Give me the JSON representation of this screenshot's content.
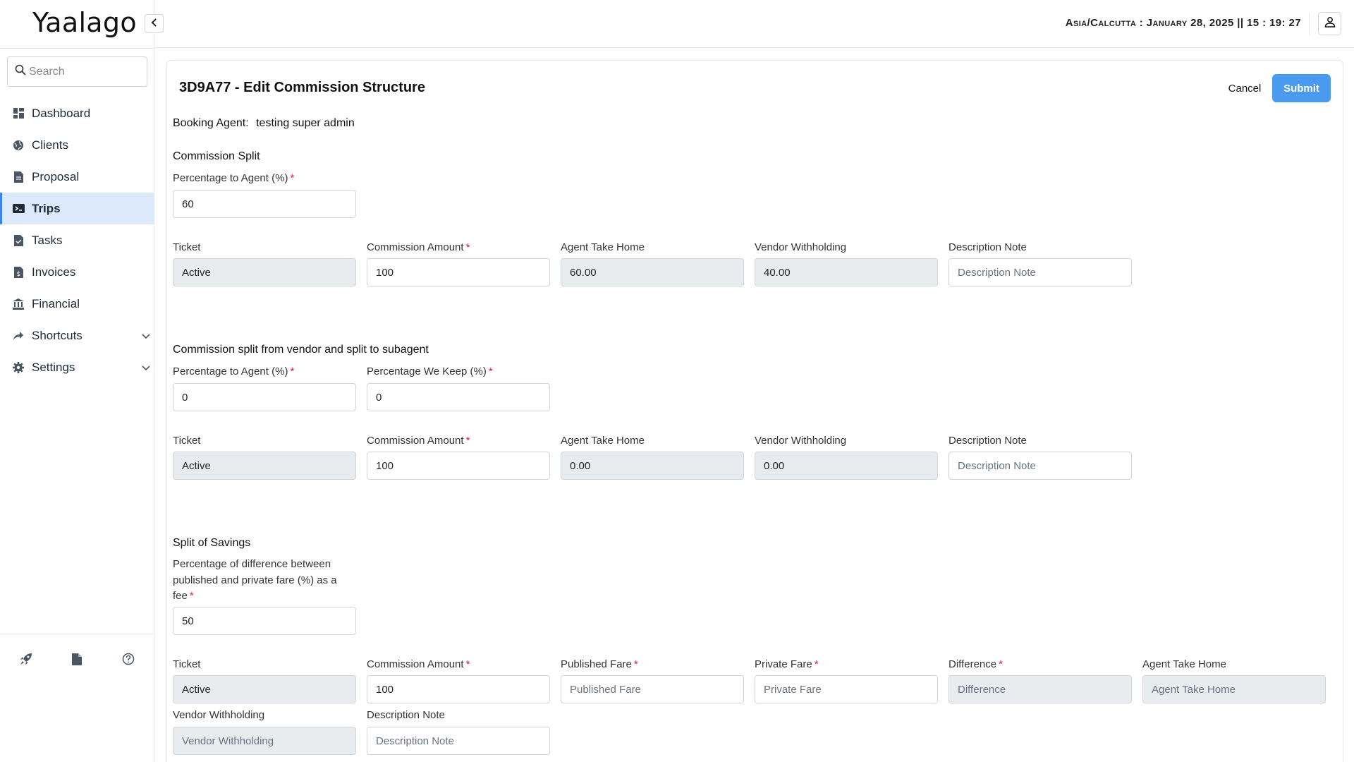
{
  "app": {
    "brand": "Yaalago"
  },
  "search": {
    "placeholder": "Search"
  },
  "sidebar": {
    "items": [
      {
        "label": "Dashboard",
        "icon": "dashboard-icon"
      },
      {
        "label": "Clients",
        "icon": "globe-icon"
      },
      {
        "label": "Proposal",
        "icon": "document-icon"
      },
      {
        "label": "Trips",
        "icon": "ticket-icon",
        "active": true
      },
      {
        "label": "Tasks",
        "icon": "task-icon"
      },
      {
        "label": "Invoices",
        "icon": "invoice-icon"
      },
      {
        "label": "Financial",
        "icon": "bank-icon"
      },
      {
        "label": "Shortcuts",
        "icon": "share-icon",
        "expandable": true
      },
      {
        "label": "Settings",
        "icon": "gear-icon",
        "expandable": true
      }
    ],
    "bottom_icons": [
      "rocket-icon",
      "file-icon",
      "help-icon"
    ]
  },
  "topbar": {
    "clock": "Asia/Calcutta : January 28, 2025 || 15 : 19: 27"
  },
  "page": {
    "title": "3D9A77 - Edit Commission Structure",
    "cancel_label": "Cancel",
    "submit_label": "Submit",
    "booking_agent_label": "Booking Agent:",
    "booking_agent_value": "testing super admin"
  },
  "commission_split": {
    "title": "Commission Split",
    "pct_label": "Percentage to Agent (%)",
    "pct_value": "60",
    "row": {
      "ticket_label": "Ticket",
      "ticket_value": "Active",
      "amount_label": "Commission Amount",
      "amount_value": "100",
      "take_home_label": "Agent Take Home",
      "take_home_value": "60.00",
      "withholding_label": "Vendor Withholding",
      "withholding_value": "40.00",
      "note_label": "Description Note",
      "note_placeholder": "Description Note"
    }
  },
  "vendor_split": {
    "title": "Commission split from vendor and split to subagent",
    "pct_agent_label": "Percentage to Agent (%)",
    "pct_agent_value": "0",
    "pct_keep_label": "Percentage We Keep (%)",
    "pct_keep_value": "0",
    "row": {
      "ticket_label": "Ticket",
      "ticket_value": "Active",
      "amount_label": "Commission Amount",
      "amount_value": "100",
      "take_home_label": "Agent Take Home",
      "take_home_value": "0.00",
      "withholding_label": "Vendor Withholding",
      "withholding_value": "0.00",
      "note_label": "Description Note",
      "note_placeholder": "Description Note"
    }
  },
  "savings_split": {
    "title": "Split of Savings",
    "pct_label_line1": "Percentage of difference between",
    "pct_label_line2": "published and private fare (%) as a",
    "pct_label_line3": "fee",
    "pct_value": "50",
    "row": {
      "ticket_label": "Ticket",
      "ticket_value": "Active",
      "amount_label": "Commission Amount",
      "amount_value": "100",
      "published_label": "Published Fare",
      "published_placeholder": "Published Fare",
      "private_label": "Private Fare",
      "private_placeholder": "Private Fare",
      "difference_label": "Difference",
      "difference_placeholder": "Difference",
      "take_home_label": "Agent Take Home",
      "take_home_placeholder": "Agent Take Home",
      "withholding_label": "Vendor Withholding",
      "withholding_placeholder": "Vendor Withholding",
      "note_label": "Description Note",
      "note_placeholder": "Description Note"
    }
  },
  "colors": {
    "accent": "#4a9af0",
    "active_nav_bg": "#dbe9fb",
    "required": "#e11d48",
    "readonly_bg": "#e9ecef"
  }
}
